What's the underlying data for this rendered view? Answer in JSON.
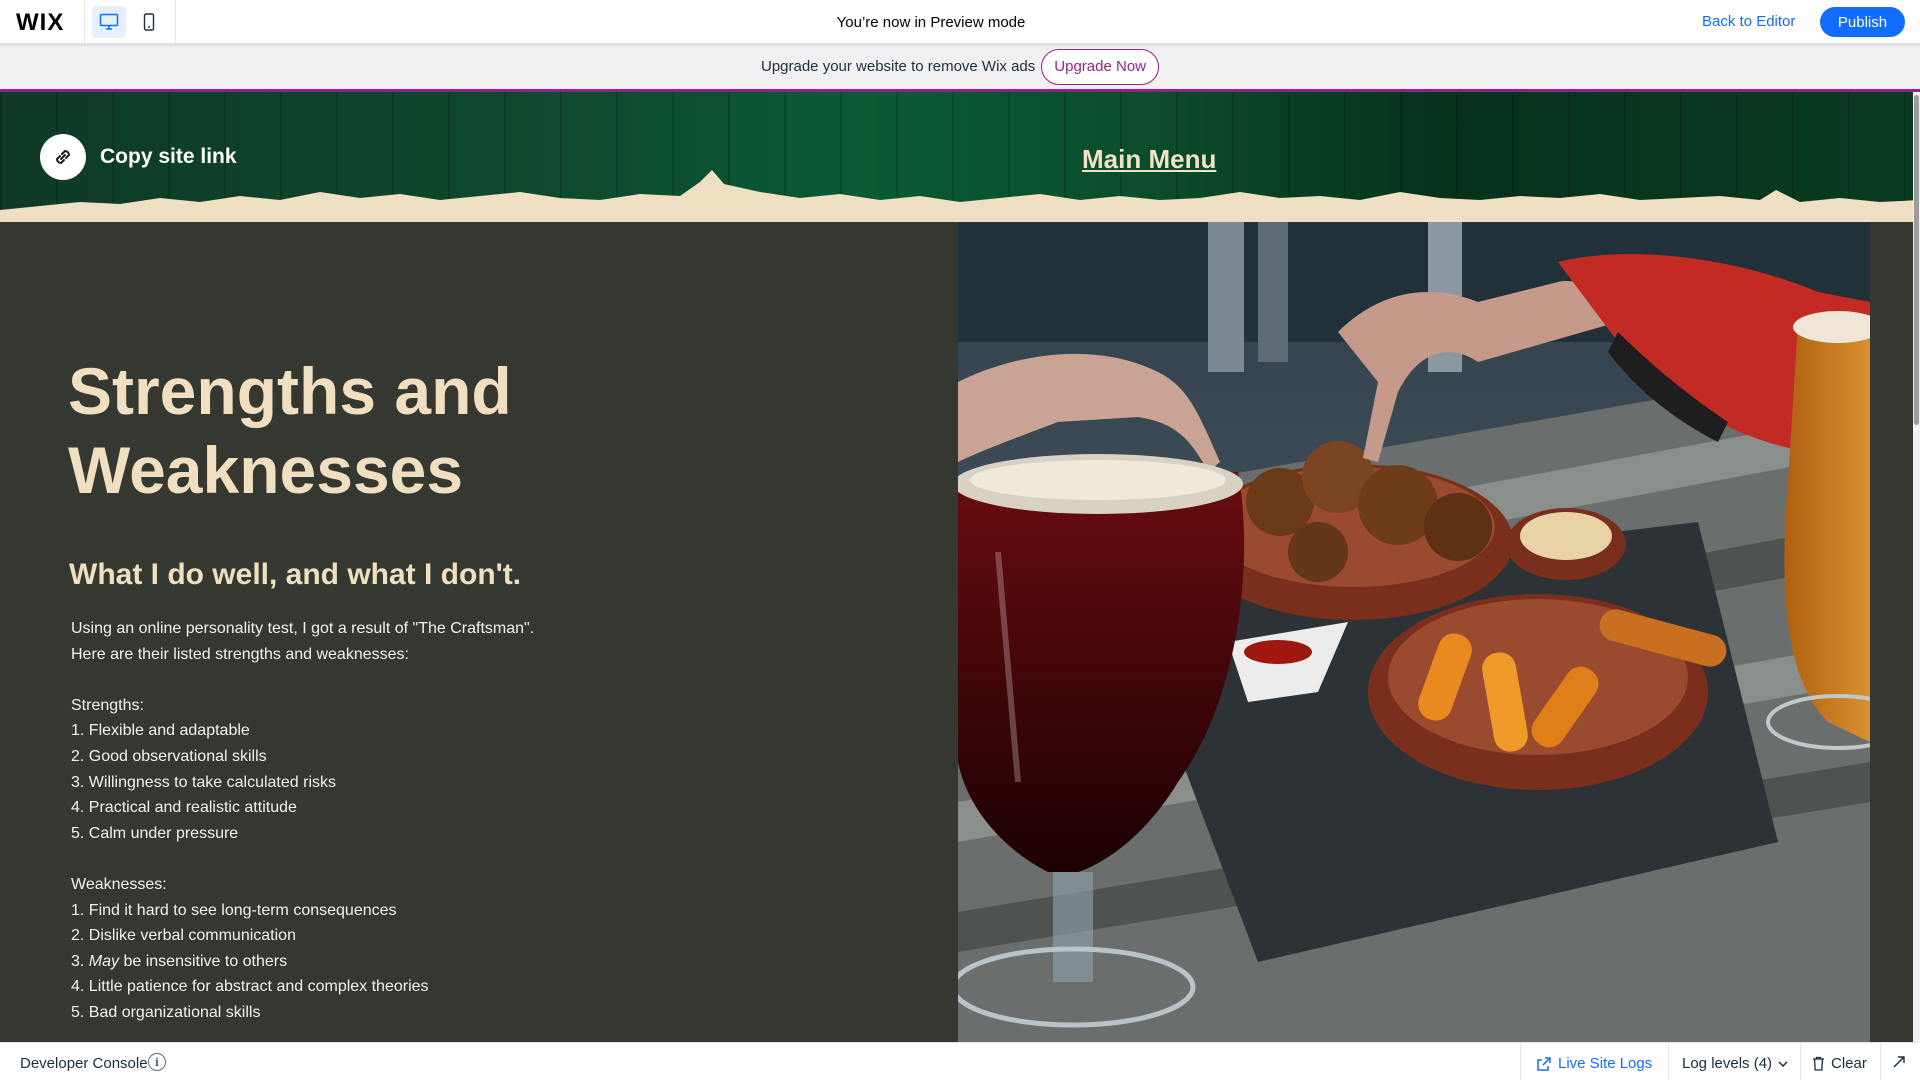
{
  "topbar": {
    "logo": "WIX",
    "preview_title": "You’re now in Preview mode",
    "back_to_editor": "Back to Editor",
    "publish": "Publish",
    "accent_color": "#116dff"
  },
  "banner": {
    "text": "Upgrade your website to remove Wix ads",
    "upgrade_button": "Upgrade Now",
    "accent_color": "#9a1f8a"
  },
  "site_header": {
    "copy_link_label": "Copy site link",
    "main_menu": "Main Menu"
  },
  "page": {
    "heading": "Strengths and Weaknesses",
    "subheading": "What I do well, and what I don't.",
    "intro": "Using an online personality test, I got a result of \"The Craftsman\". Here are their listed strengths and weaknesses:",
    "strengths_title": "Strengths:",
    "strengths": [
      "1. Flexible and adaptable",
      "2. Good observational skills",
      "3. Willingness to take calculated risks",
      "4. Practical and realistic attitude",
      "5. Calm under pressure"
    ],
    "weaknesses_title": "Weaknesses:",
    "weaknesses": [
      "1. Find it hard to see long-term consequences",
      "2. Dislike verbal communication",
      "3. ",
      "4. Little patience for abstract and complex theories",
      "5. Bad organizational skills"
    ],
    "weakness_3_emphasis": "May",
    "weakness_3_rest": " be insensitive to others",
    "text_color": "#f0dfc1",
    "background_color": "#353830"
  },
  "dev_console": {
    "title": "Developer Console",
    "info_glyph": "i",
    "live_site_logs": "Live Site Logs",
    "log_levels": "Log levels (4)",
    "clear": "Clear"
  }
}
